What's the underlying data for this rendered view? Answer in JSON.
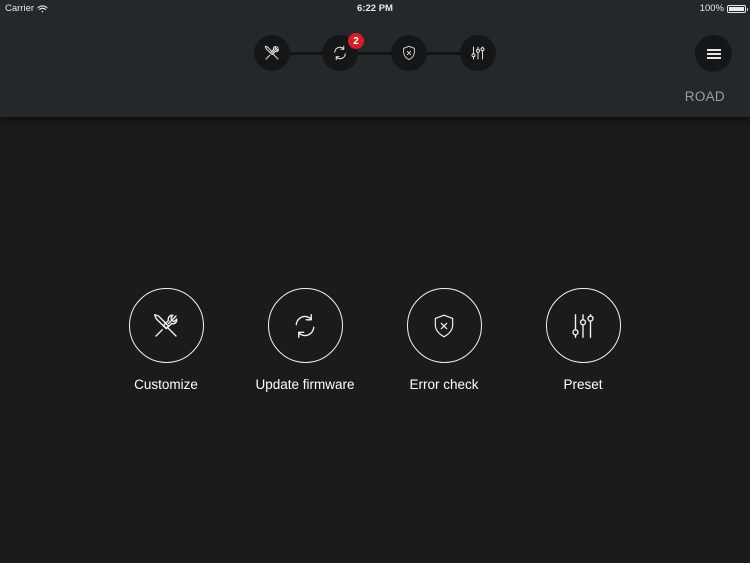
{
  "status_bar": {
    "carrier": "Carrier",
    "time": "6:22 PM",
    "battery": "100%",
    "icons": [
      "wifi-icon",
      "battery-icon"
    ]
  },
  "header": {
    "steps": [
      {
        "name": "customize",
        "icon": "wrench-screwdriver-icon"
      },
      {
        "name": "update-firmware",
        "icon": "sync-icon",
        "badge": "2"
      },
      {
        "name": "error-check",
        "icon": "shield-x-icon"
      },
      {
        "name": "preset",
        "icon": "sliders-icon"
      }
    ],
    "menu_icon": "list-icon",
    "mode": "ROAD"
  },
  "actions": [
    {
      "label": "Customize",
      "icon": "wrench-screwdriver-icon"
    },
    {
      "label": "Update firmware",
      "icon": "sync-icon"
    },
    {
      "label": "Error check",
      "icon": "shield-x-icon"
    },
    {
      "label": "Preset",
      "icon": "sliders-icon"
    }
  ],
  "colors": {
    "background": "#1b1b1c",
    "header": "#25282b",
    "badge": "#d71e23",
    "mode_text": "#9a9c9e"
  }
}
